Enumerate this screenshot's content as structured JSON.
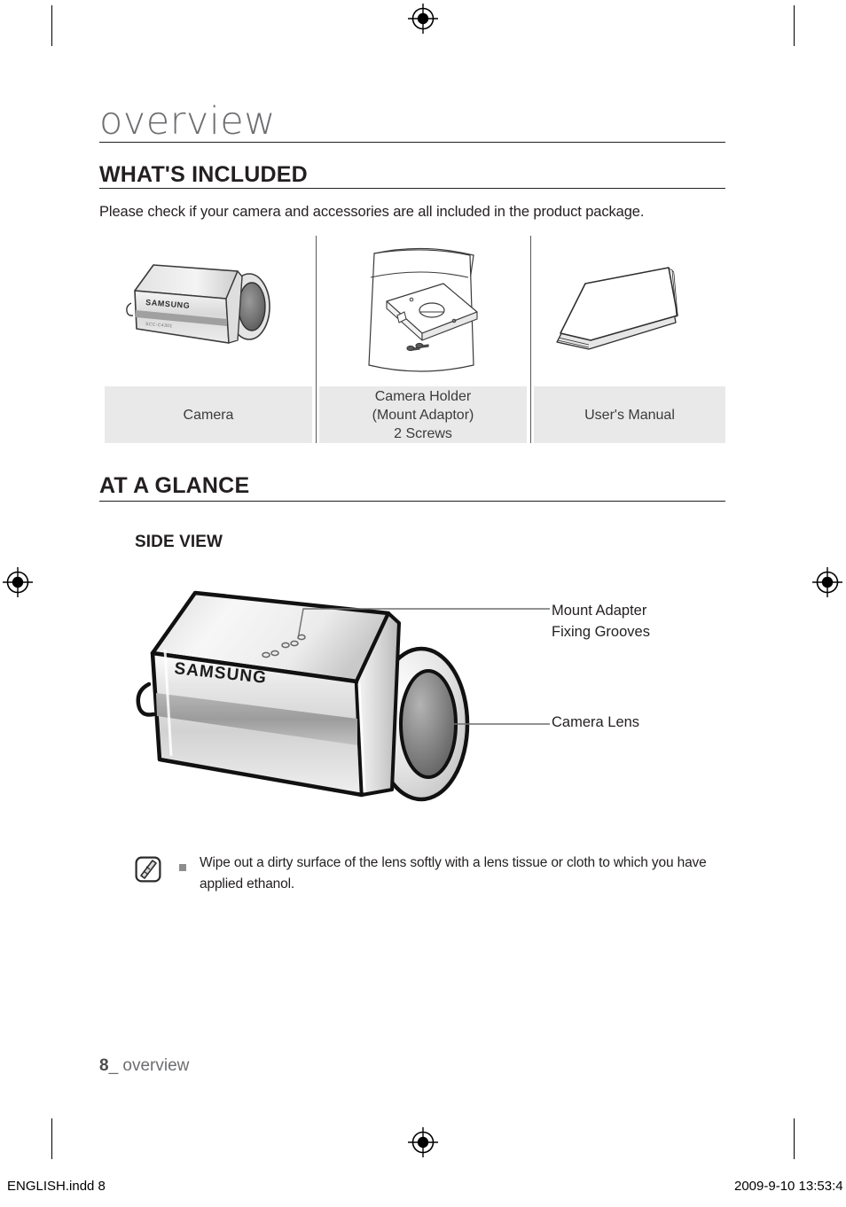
{
  "chapter": {
    "title": "overview"
  },
  "sections": {
    "whats_included": {
      "heading": "WHAT'S INCLUDED",
      "intro": "Please check if your camera and accessories are all included in the product package.",
      "items": [
        {
          "caption": "Camera",
          "art": "box-camera-illustration"
        },
        {
          "caption": "Camera Holder\n(Mount Adaptor)\n2 Screws",
          "caption_line1": "Camera Holder",
          "caption_line2": "(Mount Adaptor)",
          "caption_line3": "2 Screws",
          "art": "mount-adaptor-bag-illustration"
        },
        {
          "caption": "User's Manual",
          "art": "manual-booklet-illustration"
        }
      ]
    },
    "at_a_glance": {
      "heading": "AT A GLANCE",
      "subheading": "SIDE VIEW",
      "figure": {
        "brand_label": "SAMSUNG",
        "callouts": [
          {
            "label_line1": "Mount Adapter",
            "label_line2": "Fixing Grooves"
          },
          {
            "label_line1": "Camera Lens"
          }
        ]
      },
      "note": {
        "icon": "note-pencil-icon",
        "bullet": "square-bullet",
        "text": "Wipe out a dirty surface of the lens softly with a lens tissue or cloth to which you have applied ethanol."
      }
    }
  },
  "footer": {
    "page_number": "8",
    "page_suffix": "_ overview",
    "file_name": "ENGLISH.indd   8",
    "timestamp": "2009-9-10   13:53:4"
  },
  "colors": {
    "text": "#231f20",
    "muted": "#6d6e71",
    "caption_bg": "#e9e9e9",
    "rule": "#231f20"
  }
}
